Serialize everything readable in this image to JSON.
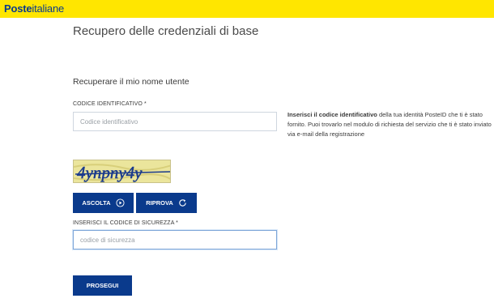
{
  "header": {
    "logo_bold": "Poste",
    "logo_regular": "italiane"
  },
  "page": {
    "title": "Recupero delle credenziali di base",
    "section_title": "Recuperare il mio nome utente"
  },
  "form": {
    "code_label": "CODICE IDENTIFICATIVO *",
    "code_placeholder": "Codice identificativo",
    "captcha_text": "4ynpny4y",
    "listen_label": "ASCOLTA",
    "retry_label": "RIPROVA",
    "security_label": "INSERISCI IL CODICE DI SICUREZZA *",
    "security_placeholder": "codice di sicurezza",
    "submit_label": "PROSEGUI"
  },
  "help": {
    "bold": "Inserisci il codice identificativo",
    "text": " della tua identità PosteID che ti è stato fornito. Puoi trovarlo nel modulo di richiesta del servizio che ti è stato inviato via e-mail della registrazione"
  },
  "colors": {
    "brand_yellow": "#ffe600",
    "brand_blue": "#0a3a8c"
  },
  "icons": {
    "listen": "play-circle-icon",
    "retry": "refresh-icon"
  }
}
